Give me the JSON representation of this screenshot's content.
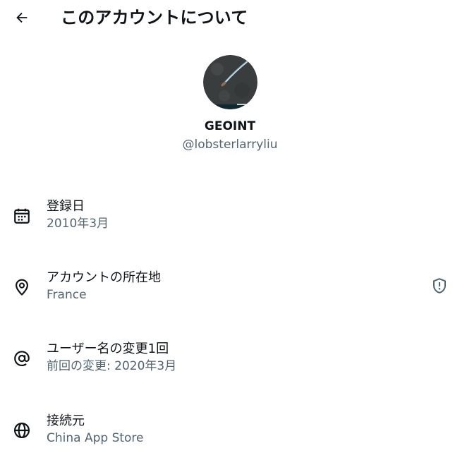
{
  "header": {
    "back_icon": "arrow-left-icon",
    "title": "このアカウントについて"
  },
  "profile": {
    "display_name": "GEOINT",
    "handle": "@lobsterlarryliu"
  },
  "details": {
    "joined": {
      "icon": "calendar-icon",
      "title": "登録日",
      "value": "2010年3月"
    },
    "location": {
      "icon": "location-pin-icon",
      "title": "アカウントの所在地",
      "value": "France",
      "badge_icon": "shield-alert-icon"
    },
    "username_changes": {
      "icon": "at-sign-icon",
      "title": "ユーザー名の変更1回",
      "value": "前回の変更: 2020年3月"
    },
    "connected_via": {
      "icon": "globe-icon",
      "title": "接続元",
      "value": "China App Store"
    }
  },
  "colors": {
    "text_primary": "#0f1419",
    "text_secondary": "#536471",
    "background": "#ffffff"
  }
}
